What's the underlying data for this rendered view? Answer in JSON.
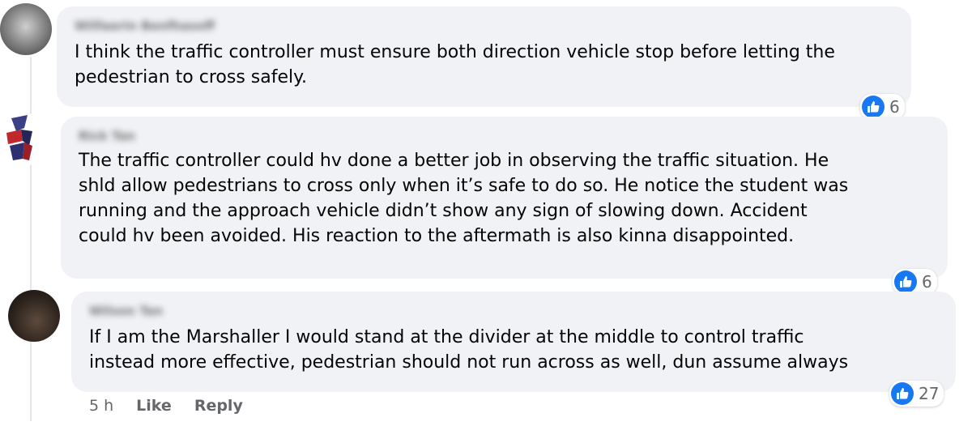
{
  "comments": [
    {
      "author": "Wilfaerin Benfhasoff",
      "text": "I think the traffic controller must ensure both direction vehicle stop before letting the\npedestrian to cross safely.",
      "reactions": "6"
    },
    {
      "author": "Rick Tan",
      "text": "The traffic controller could hv done a better job in observing the traffic situation. He\nshld allow pedestrians to cross only when it’s safe to do so. He notice the student was\nrunning and the approach vehicle didn’t show any sign of slowing down. Accident\ncould hv been avoided. His reaction to the aftermath is also kinna disappointed.",
      "reactions": "6"
    },
    {
      "author": "Wilson Tan",
      "text": "If I am the Marshaller I would stand at the divider at the middle to control traffic\ninstead more effective, pedestrian should not run across as well, dun assume always",
      "reactions": "27"
    }
  ],
  "actions": {
    "time": "5 h",
    "like": "Like",
    "reply": "Reply"
  },
  "colors": {
    "bubble": "#f0f2f5",
    "like_blue": "#1877f2",
    "meta_gray": "#65676b"
  },
  "icons": {
    "reaction": "thumbs-up-icon"
  }
}
